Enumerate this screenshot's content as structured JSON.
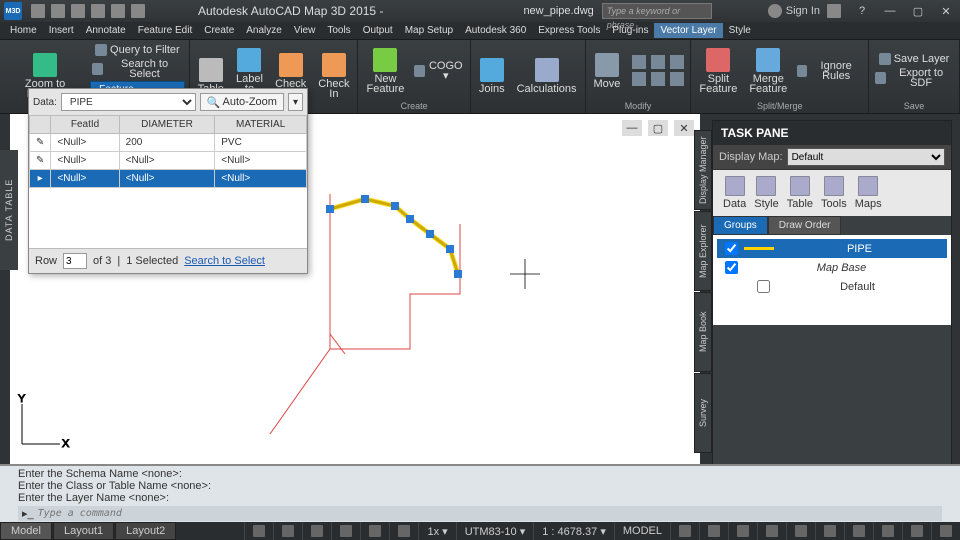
{
  "title": "Autodesk AutoCAD Map 3D 2015 -",
  "filename": "new_pipe.dwg",
  "search_placeholder": "Type a keyword or phrase",
  "signin": "Sign In",
  "menus": [
    "Home",
    "Insert",
    "Annotate",
    "Feature Edit",
    "Create",
    "Analyze",
    "View",
    "Tools",
    "Output",
    "Map Setup",
    "Autodesk 360",
    "Express Tools",
    "Plug-ins",
    "Vector Layer",
    "Style"
  ],
  "menu_active": 13,
  "ribbon": {
    "panels": [
      {
        "label": "",
        "items": [
          {
            "t": "Zoom to Extents",
            "c": "#3b8"
          }
        ],
        "side": [
          {
            "t": "Query to Filter"
          },
          {
            "t": "Search to Select"
          }
        ],
        "feature_selectable": "Feature Selectable"
      },
      {
        "label": "",
        "items": [
          {
            "t": "Table",
            "c": "#bbb"
          },
          {
            "t": "Label to\nText",
            "c": "#5ad"
          },
          {
            "t": "Check\nOut",
            "c": "#e95"
          },
          {
            "t": "Check\nIn",
            "c": "#e95"
          }
        ]
      },
      {
        "label": "Create",
        "items": [
          {
            "t": "New\nFeature",
            "c": "#7c4"
          }
        ],
        "side": [
          {
            "t": "COGO ▾"
          }
        ]
      },
      {
        "label": "",
        "items": [
          {
            "t": "Joins",
            "c": "#5ad"
          },
          {
            "t": "Calculations",
            "c": "#9ac"
          }
        ]
      },
      {
        "label": "Modify",
        "items": [
          {
            "t": "Move",
            "c": "#89a"
          }
        ],
        "grid": 6
      },
      {
        "label": "Split/Merge",
        "items": [
          {
            "t": "Split\nFeature",
            "c": "#d66"
          },
          {
            "t": "Merge\nFeature",
            "c": "#6ad"
          }
        ],
        "side": [
          {
            "t": "Ignore Rules"
          }
        ]
      },
      {
        "label": "Save",
        "items": [],
        "side": [
          {
            "t": "Save Layer"
          },
          {
            "t": "Export to SDF"
          }
        ]
      }
    ]
  },
  "data_table": {
    "tab": "DATA TABLE",
    "label": "Data:",
    "source": "PIPE",
    "autozoom": "Auto-Zoom",
    "cols": [
      "",
      "FeatId",
      "DIAMETER",
      "MATERIAL"
    ],
    "rows": [
      {
        "sel": false,
        "cells": [
          "<Null>",
          "200",
          "PVC"
        ]
      },
      {
        "sel": false,
        "cells": [
          "<Null>",
          "<Null>",
          "<Null>"
        ]
      },
      {
        "sel": true,
        "cells": [
          "<Null>",
          "<Null>",
          "<Null>"
        ]
      }
    ],
    "foot": {
      "row_lbl": "Row",
      "row": "3",
      "of": "of 3",
      "sel": "1 Selected",
      "link": "Search to Select"
    }
  },
  "task_pane": {
    "title": "TASK PANE",
    "display_map": "Display Map:",
    "display_map_val": "Default",
    "tools": [
      "Data",
      "Style",
      "Table",
      "Tools",
      "Maps"
    ],
    "tabs": [
      "Groups",
      "Draw Order"
    ],
    "tab_active": 0,
    "layers": [
      {
        "checked": true,
        "name": "PIPE",
        "sel": true,
        "swatch": "#ffd400"
      },
      {
        "checked": true,
        "name": "Map Base",
        "italic": true
      },
      {
        "checked": false,
        "name": "Default",
        "indent": true
      }
    ]
  },
  "side_tabs": [
    "Display Manager",
    "Map Explorer",
    "Map Book",
    "Survey"
  ],
  "command": {
    "history": [
      "Enter the Schema Name <none>:",
      "Enter the Class or Table Name <none>:",
      "Enter the Layer Name <none>:"
    ],
    "placeholder": "Type a command"
  },
  "status": {
    "tabs": [
      "Model",
      "Layout1",
      "Layout2"
    ],
    "tab_active": 0,
    "segs": [
      "1x ▾",
      "UTM83-10 ▾",
      "1 : 4678.37 ▾",
      "MODEL"
    ]
  }
}
